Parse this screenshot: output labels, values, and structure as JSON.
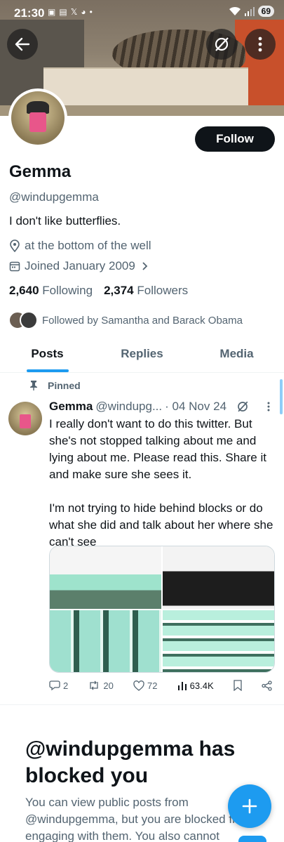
{
  "status_bar": {
    "time": "21:30",
    "battery": "69"
  },
  "profile": {
    "name": "Gemma",
    "handle": "@windupgemma",
    "bio": "I don't like butterflies.",
    "location": "at the bottom of the well",
    "joined": "Joined January 2009",
    "following_count": "2,640",
    "following_label": "Following",
    "followers_count": "2,374",
    "followers_label": "Followers",
    "followed_by": "Followed by Samantha and Barack Obama",
    "follow_label": "Follow"
  },
  "tabs": [
    {
      "label": "Posts",
      "active": true
    },
    {
      "label": "Replies",
      "active": false
    },
    {
      "label": "Media",
      "active": false
    }
  ],
  "post": {
    "pinned_label": "Pinned",
    "author": "Gemma",
    "handle": "@windupg...",
    "date": "· 04 Nov 24",
    "text": "I really don't want to do this twitter.  But she's not stopped talking about me and lying about me.  Please read this.  Share it and make sure she sees it.\n\nI'm not trying to hide behind blocks or do what she did and talk about her where she can't see",
    "replies": "2",
    "reposts": "20",
    "likes": "72",
    "views": "63.4K"
  },
  "blocked": {
    "title": "@windupgemma has blocked you",
    "text": "You can view public posts from @windupgemma, but you are blocked from engaging with them. You also cannot"
  },
  "colors": {
    "accent": "#1d9bf0",
    "text": "#0f1419",
    "muted": "#536471"
  }
}
